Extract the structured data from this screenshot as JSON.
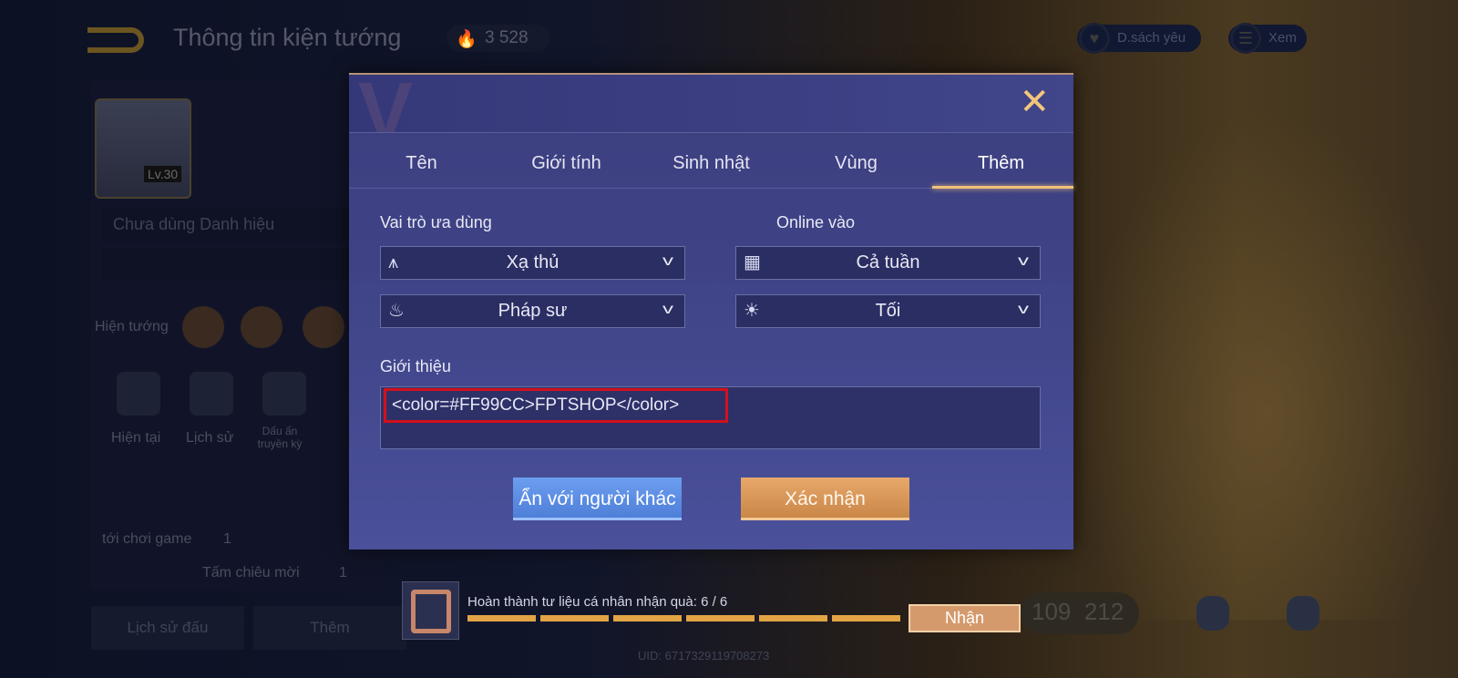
{
  "header": {
    "title": "Thông tin kiện tướng",
    "fire_count": "3 528",
    "favorites_label": "D.sách yêu",
    "view_label": "Xem"
  },
  "profile": {
    "level": "Lv.30",
    "title_field": "Chưa dùng Danh hiệu",
    "heroes_label": "Hiện tướng",
    "badges": [
      "Hiện tại",
      "Lịch sử",
      "Dấu ấn truyền kỳ"
    ],
    "play_label": "tới chơi game",
    "play_count": "1",
    "new_label": "Tấm chiêu mời",
    "new_count": "1",
    "bottom_buttons": [
      "Lịch sử đấu",
      "Thêm"
    ],
    "uid": "UID: 6717329119708273",
    "stats": [
      "109",
      "212"
    ]
  },
  "dialog": {
    "tabs": [
      {
        "label": "Tên"
      },
      {
        "label": "Giới tính"
      },
      {
        "label": "Sinh nhật"
      },
      {
        "label": "Vùng"
      },
      {
        "label": "Thêm",
        "active": true
      }
    ],
    "role_label": "Vai trò ưa dùng",
    "roles": [
      {
        "value": "Xạ thủ",
        "icon": "archer-icon"
      },
      {
        "value": "Pháp sư",
        "icon": "mage-icon"
      }
    ],
    "online_label": "Online vào",
    "online": [
      {
        "value": "Cả tuần",
        "icon": "calendar-icon"
      },
      {
        "value": "Tối",
        "icon": "sun-icon"
      }
    ],
    "intro_label": "Giới thiệu",
    "intro_value": "<color=#FF99CC>FPTSHOP</color>",
    "hide_button": "Ẩn với người khác",
    "confirm_button": "Xác nhận",
    "highlight_color": "#d2101c"
  },
  "reward": {
    "text": "Hoàn thành tư liệu cá nhân nhận quà: 6 / 6",
    "progress": "6/6",
    "button": "Nhận"
  }
}
